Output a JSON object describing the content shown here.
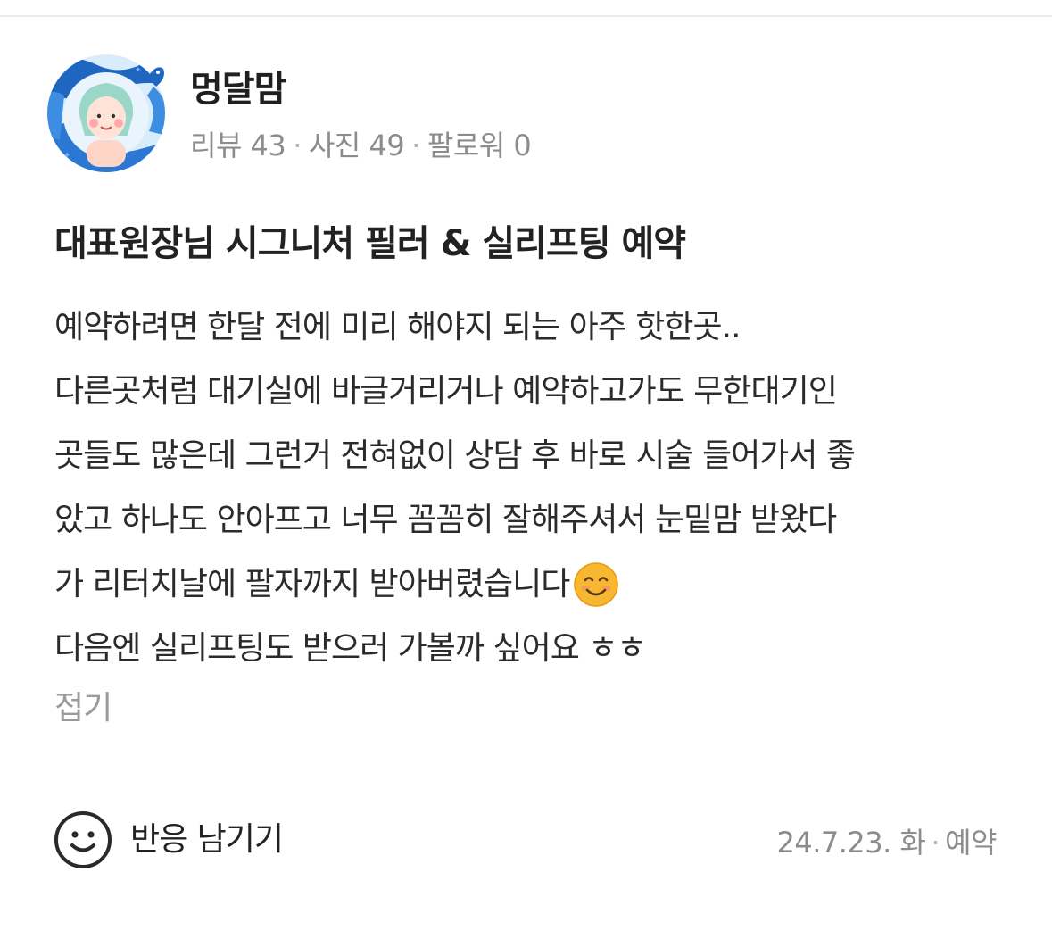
{
  "review": {
    "author": {
      "name": "멍달맘",
      "reviews_label": "리뷰 43",
      "photos_label": "사진 49",
      "followers_label": "팔로워 0",
      "separator": "·"
    },
    "title": "대표원장님 시그니처 필러 & 실리프팅 예약",
    "body_lines": [
      "예약하려면 한달 전에 미리 해야지 되는 아주 핫한곳..",
      "다른곳처럼 대기실에 바글거리거나 예약하고가도 무한대기인",
      "곳들도 많은데 그런거 전혀없이 상담 후 바로 시술 들어가서 좋",
      "았고 하나도 안아프고 너무 꼼꼼히 잘해주셔서 눈밑맘 받왔다",
      "가 리터치날에 팔자까지 받아버렸습니다",
      "다음엔 실리프팅도 받으러 가볼까 싶어요 ㅎㅎ"
    ],
    "emoji": "smiling-face-emoji",
    "fold_label": "접기",
    "reaction_label": "반응 남기기",
    "date": "24.7.23. 화",
    "visit_type": "예약"
  },
  "icons": {
    "avatar": "avatar-illustration",
    "reaction": "smile-outline-icon"
  },
  "colors": {
    "avatar_blue": "#3b82d6",
    "avatar_hair": "#8fd3c4",
    "emoji_yellow": "#f7b731",
    "muted_text": "#8c8c8c"
  }
}
